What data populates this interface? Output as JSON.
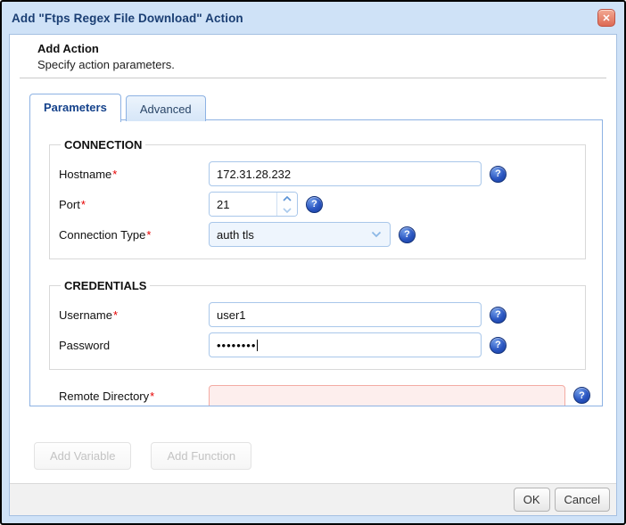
{
  "ui": {
    "required_mark": "*"
  },
  "icons": {
    "close_glyph": "✕",
    "help_glyph": "?"
  },
  "window": {
    "title": "Add \"Ftps Regex File Download\" Action"
  },
  "header": {
    "title": "Add Action",
    "subtitle": "Specify action parameters."
  },
  "tabs": {
    "parameters": "Parameters",
    "advanced": "Advanced"
  },
  "connection": {
    "legend": "CONNECTION",
    "hostname_label": "Hostname",
    "hostname_value": "172.31.28.232",
    "port_label": "Port",
    "port_value": "21",
    "type_label": "Connection Type",
    "type_value": "auth tls"
  },
  "credentials": {
    "legend": "CREDENTIALS",
    "username_label": "Username",
    "username_value": "user1",
    "password_label": "Password",
    "password_value": "••••••••"
  },
  "remote": {
    "label": "Remote Directory",
    "value": ""
  },
  "actions": {
    "add_variable": "Add Variable",
    "add_function": "Add Function"
  },
  "footer": {
    "ok": "OK",
    "cancel": "Cancel"
  },
  "colors": {
    "title_text": "#1a3e73",
    "accent_blue": "#15428b",
    "frame_blue": "#cfe2f7",
    "tab_border": "#8db2e3",
    "input_border": "#a9c7ea",
    "error_bg": "#fdeeed",
    "error_border": "#f3aba3",
    "help_icon_blue": "#1b3f9d",
    "close_button_red": "#dd6a55",
    "required_red": "#e60000"
  }
}
